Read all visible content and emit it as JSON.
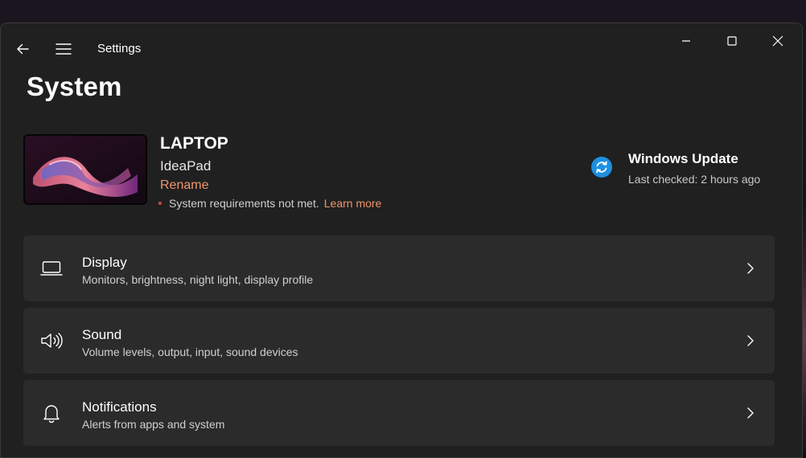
{
  "window": {
    "title": "Settings"
  },
  "page": {
    "title": "System"
  },
  "device": {
    "name": "LAPTOP",
    "model": "IdeaPad",
    "rename_label": "Rename",
    "requirements_text": "System requirements not met.",
    "learn_more_label": "Learn more"
  },
  "windows_update": {
    "title": "Windows Update",
    "status": "Last checked: 2 hours ago",
    "icon": "sync-icon",
    "accent": "#1d8fe1"
  },
  "settings": [
    {
      "title": "Display",
      "description": "Monitors, brightness, night light, display profile",
      "icon": "laptop-icon"
    },
    {
      "title": "Sound",
      "description": "Volume levels, output, input, sound devices",
      "icon": "speaker-icon"
    },
    {
      "title": "Notifications",
      "description": "Alerts from apps and system",
      "icon": "bell-icon"
    }
  ],
  "colors": {
    "accent_link": "#f0956b",
    "window_bg": "#202020",
    "card_bg": "#2b2b2b",
    "error_dot": "#d24a3c"
  }
}
